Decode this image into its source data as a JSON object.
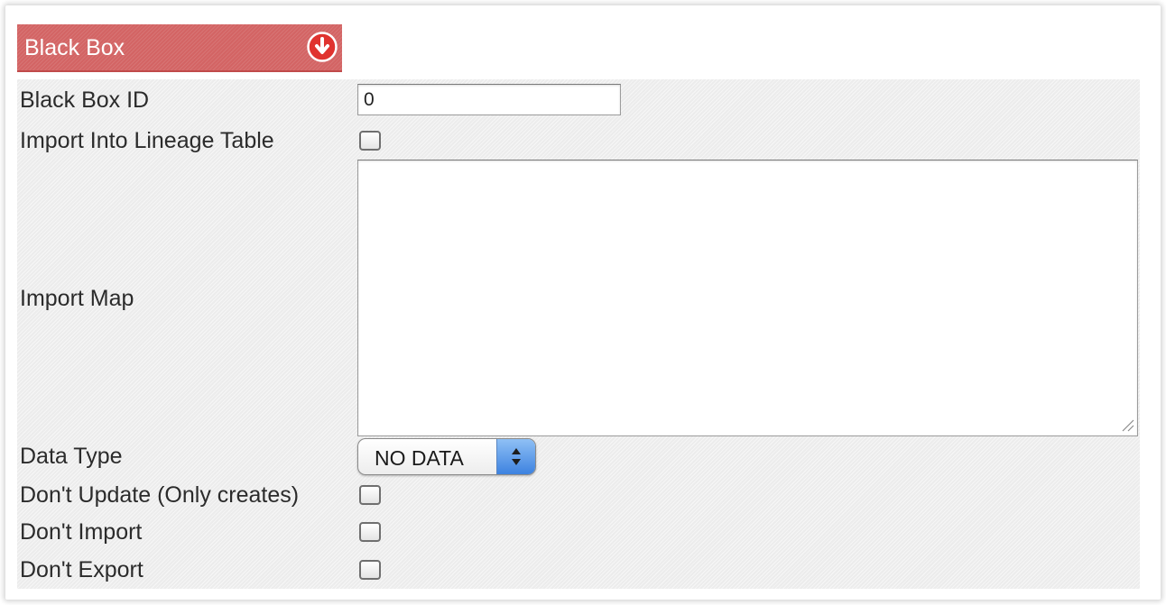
{
  "panel": {
    "title": "Black Box"
  },
  "fields": {
    "black_box_id": {
      "label": "Black Box ID",
      "value": "0"
    },
    "import_into_lineage": {
      "label": "Import Into Lineage Table",
      "checked": false
    },
    "import_map": {
      "label": "Import Map",
      "value": ""
    },
    "data_type": {
      "label": "Data Type",
      "selected": "NO DATA"
    },
    "dont_update": {
      "label": "Don't Update (Only creates)",
      "checked": false
    },
    "dont_import": {
      "label": "Don't Import",
      "checked": false
    },
    "dont_export": {
      "label": "Don't Export",
      "checked": false
    }
  },
  "icons": {
    "collapse": "collapse-down-arrow-icon",
    "select_arrows": "up-down-arrows-icon",
    "resize": "resize-grip-icon"
  },
  "colors": {
    "header_bg": "#d36464",
    "icon_red": "#e0332f",
    "select_blue": "#3d82e0"
  }
}
